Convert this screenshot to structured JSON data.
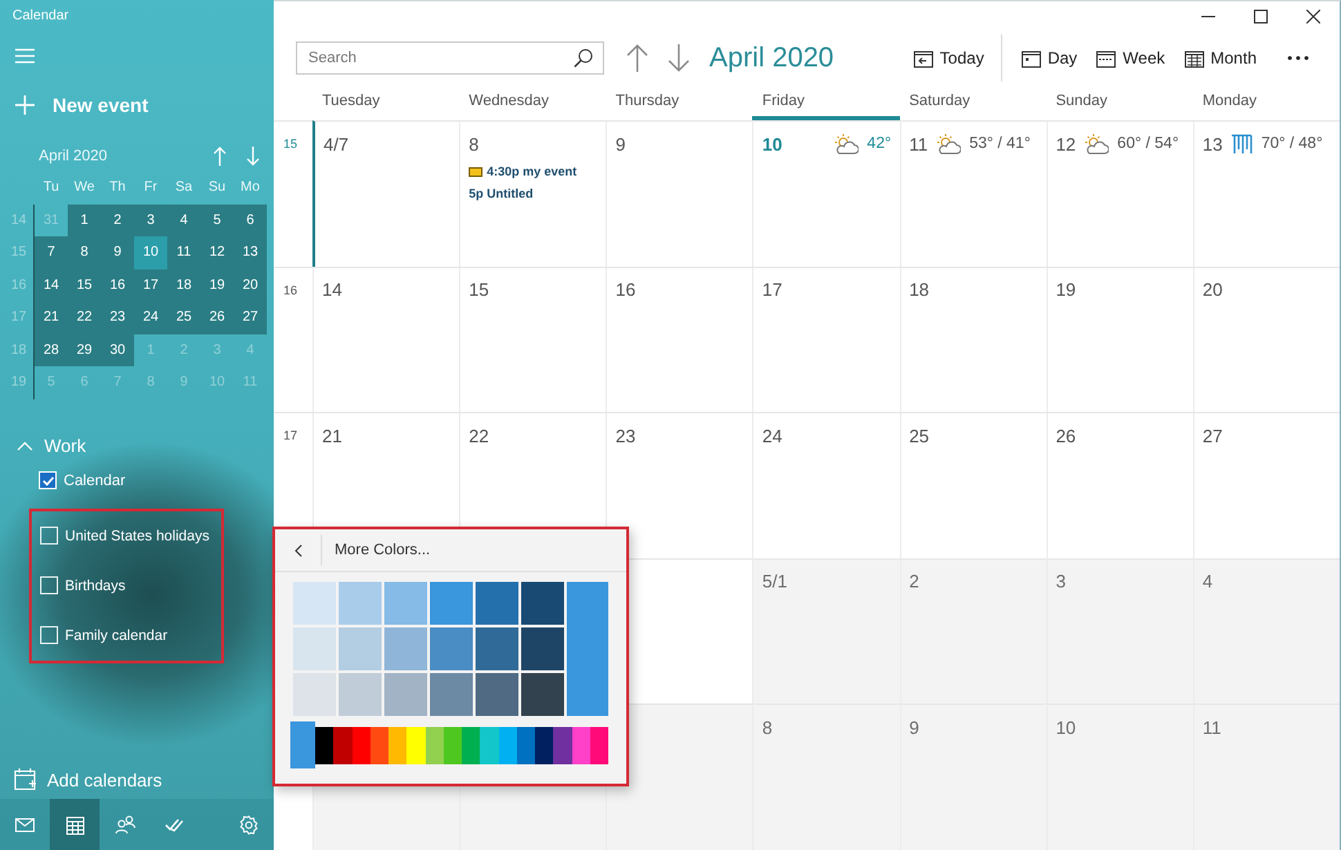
{
  "window": {
    "title": "Calendar"
  },
  "sidebar": {
    "new_event": "New event",
    "mini_calendar": {
      "title": "April 2020",
      "weekdays": [
        "Tu",
        "We",
        "Th",
        "Fr",
        "Sa",
        "Su",
        "Mo"
      ],
      "weeks": [
        {
          "week": "14",
          "days": [
            {
              "d": "31",
              "in_month": false,
              "selected": false
            },
            {
              "d": "1",
              "in_month": true,
              "selected": false
            },
            {
              "d": "2",
              "in_month": true,
              "selected": false
            },
            {
              "d": "3",
              "in_month": true,
              "selected": false
            },
            {
              "d": "4",
              "in_month": true,
              "selected": false
            },
            {
              "d": "5",
              "in_month": true,
              "selected": false
            },
            {
              "d": "6",
              "in_month": true,
              "selected": false
            }
          ]
        },
        {
          "week": "15",
          "days": [
            {
              "d": "7",
              "in_month": true,
              "selected": false
            },
            {
              "d": "8",
              "in_month": true,
              "selected": false
            },
            {
              "d": "9",
              "in_month": true,
              "selected": false
            },
            {
              "d": "10",
              "in_month": true,
              "selected": true
            },
            {
              "d": "11",
              "in_month": true,
              "selected": false
            },
            {
              "d": "12",
              "in_month": true,
              "selected": false
            },
            {
              "d": "13",
              "in_month": true,
              "selected": false
            }
          ]
        },
        {
          "week": "16",
          "days": [
            {
              "d": "14",
              "in_month": true,
              "selected": false
            },
            {
              "d": "15",
              "in_month": true,
              "selected": false
            },
            {
              "d": "16",
              "in_month": true,
              "selected": false
            },
            {
              "d": "17",
              "in_month": true,
              "selected": false
            },
            {
              "d": "18",
              "in_month": true,
              "selected": false
            },
            {
              "d": "19",
              "in_month": true,
              "selected": false
            },
            {
              "d": "20",
              "in_month": true,
              "selected": false
            }
          ]
        },
        {
          "week": "17",
          "days": [
            {
              "d": "21",
              "in_month": true,
              "selected": false
            },
            {
              "d": "22",
              "in_month": true,
              "selected": false
            },
            {
              "d": "23",
              "in_month": true,
              "selected": false
            },
            {
              "d": "24",
              "in_month": true,
              "selected": false
            },
            {
              "d": "25",
              "in_month": true,
              "selected": false
            },
            {
              "d": "26",
              "in_month": true,
              "selected": false
            },
            {
              "d": "27",
              "in_month": true,
              "selected": false
            }
          ]
        },
        {
          "week": "18",
          "days": [
            {
              "d": "28",
              "in_month": true,
              "selected": false
            },
            {
              "d": "29",
              "in_month": true,
              "selected": false
            },
            {
              "d": "30",
              "in_month": true,
              "selected": false
            },
            {
              "d": "1",
              "in_month": false,
              "selected": false
            },
            {
              "d": "2",
              "in_month": false,
              "selected": false
            },
            {
              "d": "3",
              "in_month": false,
              "selected": false
            },
            {
              "d": "4",
              "in_month": false,
              "selected": false
            }
          ]
        },
        {
          "week": "19",
          "days": [
            {
              "d": "5",
              "in_month": false,
              "selected": false
            },
            {
              "d": "6",
              "in_month": false,
              "selected": false
            },
            {
              "d": "7",
              "in_month": false,
              "selected": false
            },
            {
              "d": "8",
              "in_month": false,
              "selected": false
            },
            {
              "d": "9",
              "in_month": false,
              "selected": false
            },
            {
              "d": "10",
              "in_month": false,
              "selected": false
            },
            {
              "d": "11",
              "in_month": false,
              "selected": false
            }
          ]
        }
      ]
    },
    "account": {
      "name": "Work",
      "expanded": true,
      "calendars": [
        {
          "name": "Calendar",
          "checked": true,
          "highlighted": false
        },
        {
          "name": "United States holidays",
          "checked": false,
          "highlighted": true
        },
        {
          "name": "Birthdays",
          "checked": false,
          "highlighted": true
        },
        {
          "name": "Family calendar",
          "checked": false,
          "highlighted": true
        }
      ]
    },
    "add_calendars": "Add calendars",
    "nav": [
      {
        "kind": "mail",
        "selected": false
      },
      {
        "kind": "calendar",
        "selected": true
      },
      {
        "kind": "people",
        "selected": false
      },
      {
        "kind": "todo",
        "selected": false
      },
      {
        "kind": "settings",
        "selected": false
      }
    ]
  },
  "toolbar": {
    "search": {
      "placeholder": "Search"
    },
    "title": "April 2020",
    "today": "Today",
    "views": [
      "Day",
      "Week",
      "Month"
    ]
  },
  "month": {
    "weekdays": [
      {
        "name": "Tuesday",
        "today": false
      },
      {
        "name": "Wednesday",
        "today": false
      },
      {
        "name": "Thursday",
        "today": false
      },
      {
        "name": "Friday",
        "today": true
      },
      {
        "name": "Saturday",
        "today": false
      },
      {
        "name": "Sunday",
        "today": false
      },
      {
        "name": "Monday",
        "today": false
      }
    ],
    "weeks": [
      {
        "week": "15",
        "current": true,
        "days": [
          {
            "date": "4/7",
            "in_month": true
          },
          {
            "date": "8",
            "in_month": true,
            "events": [
              {
                "text": "4:30p my event",
                "icon": true
              },
              {
                "text": "5p Untitled",
                "icon": false
              }
            ]
          },
          {
            "date": "9",
            "in_month": true
          },
          {
            "date": "10",
            "in_month": true,
            "weather": {
              "kind": "partly-cloudy",
              "temp": "42°"
            }
          },
          {
            "date": "11",
            "in_month": true,
            "weather": {
              "kind": "partly-cloudy",
              "temp": "53° / 41°"
            }
          },
          {
            "date": "12",
            "in_month": true,
            "weather": {
              "kind": "partly-cloudy",
              "temp": "60° / 54°"
            }
          },
          {
            "date": "13",
            "in_month": true,
            "weather": {
              "kind": "rain",
              "temp": "70° / 48°"
            }
          }
        ]
      },
      {
        "week": "16",
        "current": false,
        "days": [
          {
            "date": "14",
            "in_month": true
          },
          {
            "date": "15",
            "in_month": true
          },
          {
            "date": "16",
            "in_month": true
          },
          {
            "date": "17",
            "in_month": true
          },
          {
            "date": "18",
            "in_month": true
          },
          {
            "date": "19",
            "in_month": true
          },
          {
            "date": "20",
            "in_month": true
          }
        ]
      },
      {
        "week": "17",
        "current": false,
        "days": [
          {
            "date": "21",
            "in_month": true
          },
          {
            "date": "22",
            "in_month": true
          },
          {
            "date": "23",
            "in_month": true
          },
          {
            "date": "24",
            "in_month": true
          },
          {
            "date": "25",
            "in_month": true
          },
          {
            "date": "26",
            "in_month": true
          },
          {
            "date": "27",
            "in_month": true
          }
        ]
      },
      {
        "days": [
          {
            "in_month": true
          },
          {
            "date": "5/1",
            "in_month": false
          },
          {
            "date": "2",
            "in_month": false
          },
          {
            "date": "3",
            "in_month": false
          },
          {
            "date": "4",
            "in_month": false
          }
        ]
      },
      {
        "days": [
          {
            "in_month": false
          },
          {
            "in_month": false
          },
          {
            "in_month": false
          },
          {
            "date": "8",
            "in_month": false
          },
          {
            "date": "9",
            "in_month": false
          },
          {
            "date": "10",
            "in_month": false
          },
          {
            "date": "11",
            "in_month": false
          }
        ]
      }
    ]
  },
  "color_picker": {
    "title": "More Colors...",
    "base": {
      "color": "#3a96dd"
    },
    "current": {
      "color": "#3a96dd"
    },
    "shades": [
      {
        "color": "#d6e6f5"
      },
      {
        "color": "#a9cceb"
      },
      {
        "color": "#85bbe6"
      },
      {
        "color": "#3a96dd"
      },
      {
        "color": "#2470ad"
      },
      {
        "color": "#184a73"
      },
      {
        "color": "#d8e4ee"
      },
      {
        "color": "#b3cde2"
      },
      {
        "color": "#8fb6d8"
      },
      {
        "color": "#4a8cc4"
      },
      {
        "color": "#2f6a98"
      },
      {
        "color": "#1f4566"
      },
      {
        "color": "#dde3e9"
      },
      {
        "color": "#c0cdd8"
      },
      {
        "color": "#a1b3c4"
      },
      {
        "color": "#6d8aa5"
      },
      {
        "color": "#4f6a82"
      },
      {
        "color": "#33424f"
      }
    ],
    "strip": [
      {
        "color": "#000000"
      },
      {
        "color": "#c00000"
      },
      {
        "color": "#ff0000"
      },
      {
        "color": "#ff4b12"
      },
      {
        "color": "#ffb900"
      },
      {
        "color": "#ffff00"
      },
      {
        "color": "#92d050"
      },
      {
        "color": "#4ec820"
      },
      {
        "color": "#00b050"
      },
      {
        "color": "#12c6c9"
      },
      {
        "color": "#00b0f0"
      },
      {
        "color": "#0070c0"
      },
      {
        "color": "#002060"
      },
      {
        "color": "#7030a0"
      },
      {
        "color": "#ff40c8"
      },
      {
        "color": "#ff0a78"
      }
    ]
  }
}
